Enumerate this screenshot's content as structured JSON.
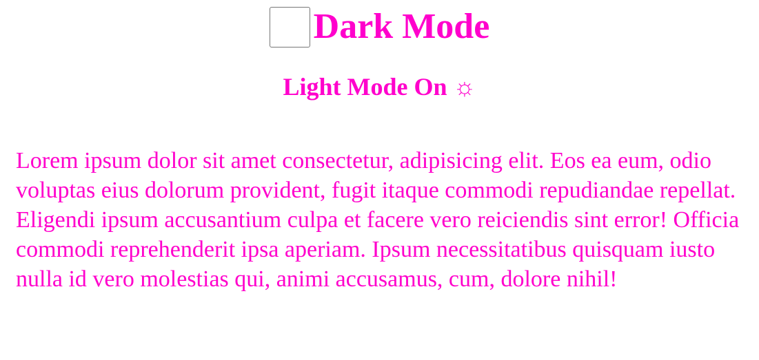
{
  "header": {
    "title": "Dark Mode",
    "toggle_checked": false
  },
  "status": {
    "text": "Light Mode On",
    "icon": "sun-icon",
    "icon_glyph": "☼"
  },
  "content": {
    "paragraph": "Lorem ipsum dolor sit amet consectetur, adipisicing elit. Eos ea eum, odio voluptas eius dolorum provident, fugit itaque commodi repudiandae repellat. Eligendi ipsum accusantium culpa et facere vero reiciendis sint error! Officia commodi reprehenderit ipsa aperiam. Ipsum necessitatibus quisquam iusto nulla id vero molestias qui, animi accusamus, cum, dolore nihil!"
  },
  "colors": {
    "text": "#ff00cc",
    "background": "#ffffff"
  }
}
